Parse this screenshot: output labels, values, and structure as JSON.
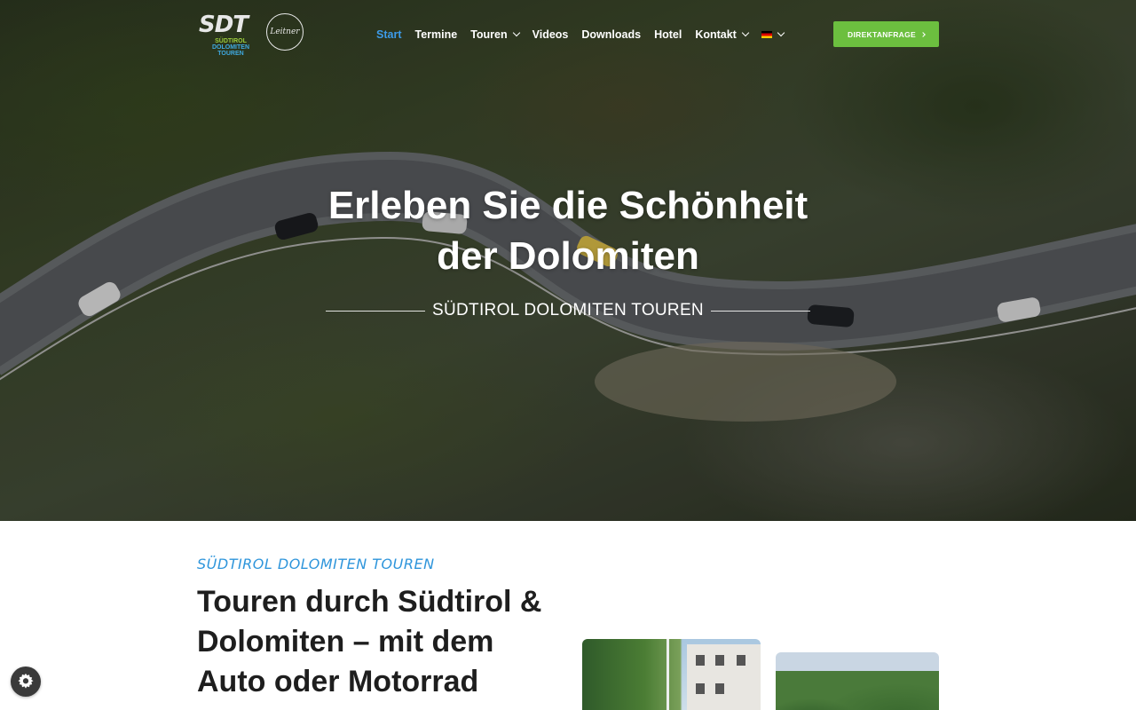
{
  "header": {
    "logo": {
      "mark": "SDT",
      "line1": "SÜDTIROL",
      "line2": "DOLOMITEN",
      "line3": "TOUREN",
      "partner": "Leitner"
    },
    "nav": [
      {
        "label": "Start",
        "active": true,
        "dropdown": false
      },
      {
        "label": "Termine",
        "active": false,
        "dropdown": false
      },
      {
        "label": "Touren",
        "active": false,
        "dropdown": true
      },
      {
        "label": "Videos",
        "active": false,
        "dropdown": false
      },
      {
        "label": "Downloads",
        "active": false,
        "dropdown": false
      },
      {
        "label": "Hotel",
        "active": false,
        "dropdown": false
      },
      {
        "label": "Kontakt",
        "active": false,
        "dropdown": true
      }
    ],
    "language_icon": "german-flag-icon",
    "cta_label": "DIREKTANFRAGE"
  },
  "hero": {
    "title_line1": "Erleben Sie die Schönheit",
    "title_line2": "der Dolomiten",
    "subtitle": "SÜDTIROL DOLOMITEN TOUREN"
  },
  "intro": {
    "eyebrow": "SÜDTIROL DOLOMITEN TOUREN",
    "title_line1": "Touren durch Südtirol &",
    "title_line2": "Dolomiten – mit dem",
    "title_line3": "Auto oder Motorrad"
  },
  "colors": {
    "accent_blue": "#3d9be9",
    "cta_green": "#6cbf3f",
    "eyebrow_blue": "#2e95db",
    "text_dark": "#1e1e1e"
  },
  "widgets": {
    "cookie_settings_icon": "gear-icon"
  }
}
